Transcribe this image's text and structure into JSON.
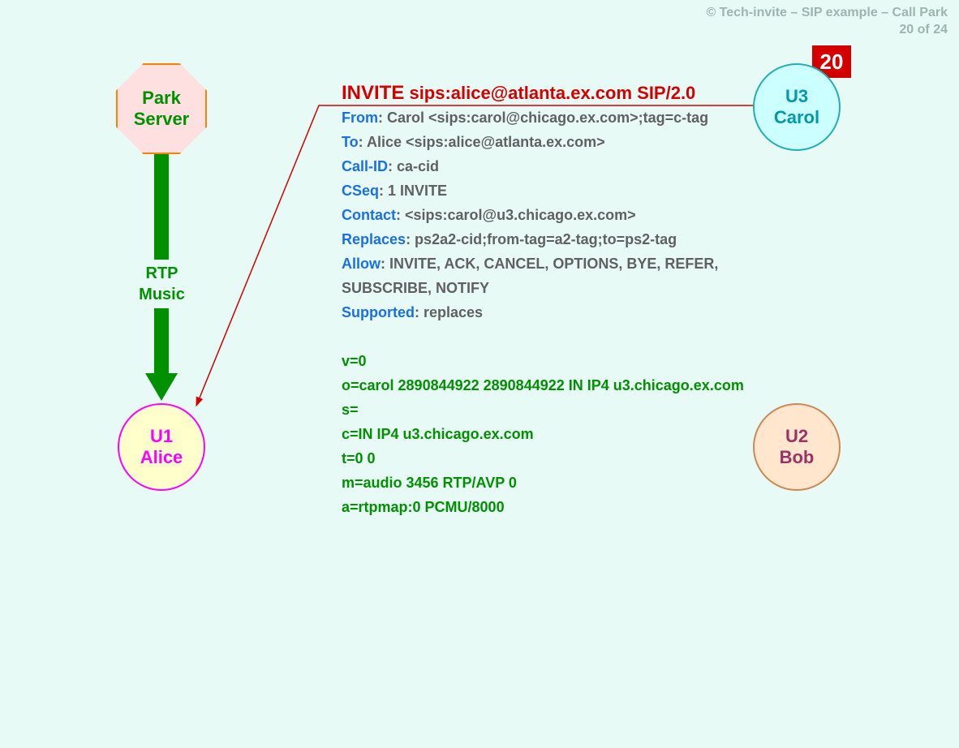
{
  "header": {
    "line1": "© Tech-invite – SIP example – Call Park",
    "line2": "20 of 24"
  },
  "step_number": "20",
  "nodes": {
    "park_server": {
      "line1": "Park",
      "line2": "Server"
    },
    "alice": {
      "line1": "U1",
      "line2": "Alice"
    },
    "bob": {
      "line1": "U2",
      "line2": "Bob"
    },
    "carol": {
      "line1": "U3",
      "line2": "Carol"
    }
  },
  "rtp_label": {
    "line1": "RTP",
    "line2": "Music"
  },
  "sip": {
    "request_method": "INVITE",
    "request_uri": " sips:alice@atlanta.ex.com SIP/2.0",
    "headers": {
      "from_name": "From",
      "from_val": ": Carol <sips:carol@chicago.ex.com>;tag=c-tag",
      "to_name": "To",
      "to_val": ": Alice <sips:alice@atlanta.ex.com>",
      "callid_name": "Call-ID",
      "callid_val": ": ca-cid",
      "cseq_name": "CSeq",
      "cseq_val": ": 1 INVITE",
      "contact_name": "Contact",
      "contact_val": ": <sips:carol@u3.chicago.ex.com>",
      "replaces_name": "Replaces",
      "replaces_val": ": ps2a2-cid;from-tag=a2-tag;to=ps2-tag",
      "allow_name": "Allow",
      "allow_val": ": INVITE, ACK, CANCEL, OPTIONS, BYE, REFER, SUBSCRIBE, NOTIFY",
      "supported_name": "Supported",
      "supported_val": ": replaces"
    },
    "sdp": {
      "l1": "v=0",
      "l2": "o=carol  2890844922  2890844922  IN  IP4  u3.chicago.ex.com",
      "l3": "s=",
      "l4": "c=IN  IP4  u3.chicago.ex.com",
      "l5": "t=0  0",
      "l6": "m=audio  3456  RTP/AVP  0",
      "l7": "a=rtpmap:0  PCMU/8000"
    }
  }
}
